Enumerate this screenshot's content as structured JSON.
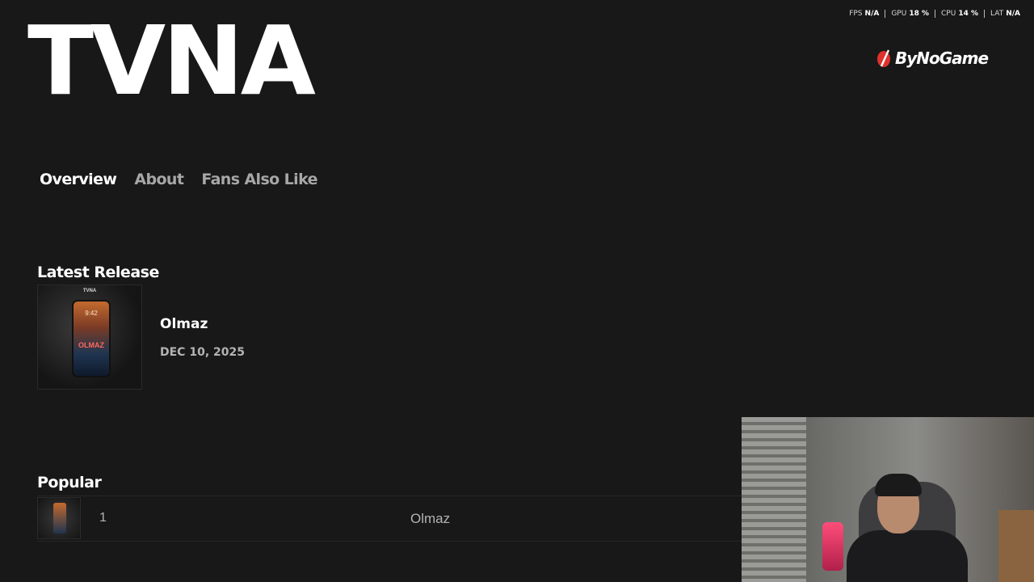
{
  "artist": {
    "name": "TVNA"
  },
  "overlay": {
    "stats": [
      {
        "label": "FPS",
        "value": "N/A"
      },
      {
        "label": "GPU",
        "value": "18 %"
      },
      {
        "label": "CPU",
        "value": "14 %"
      },
      {
        "label": "LAT",
        "value": "N/A"
      }
    ],
    "logo_text": "ByNoGame"
  },
  "tabs": [
    {
      "label": "Overview",
      "active": true
    },
    {
      "label": "About",
      "active": false
    },
    {
      "label": "Fans Also Like",
      "active": false
    }
  ],
  "latest_release": {
    "heading": "Latest Release",
    "title": "Olmaz",
    "date": "DEC 10, 2025",
    "cover": {
      "brand": "TVNA",
      "time": "9:42",
      "word": "OLMAZ"
    }
  },
  "popular": {
    "heading": "Popular",
    "tracks": [
      {
        "rank": "1",
        "title": "Olmaz"
      }
    ]
  },
  "colors": {
    "background": "#181818",
    "text_primary": "#ffffff",
    "text_secondary": "#b3b3b3",
    "logo_accent": "#e0322c"
  }
}
